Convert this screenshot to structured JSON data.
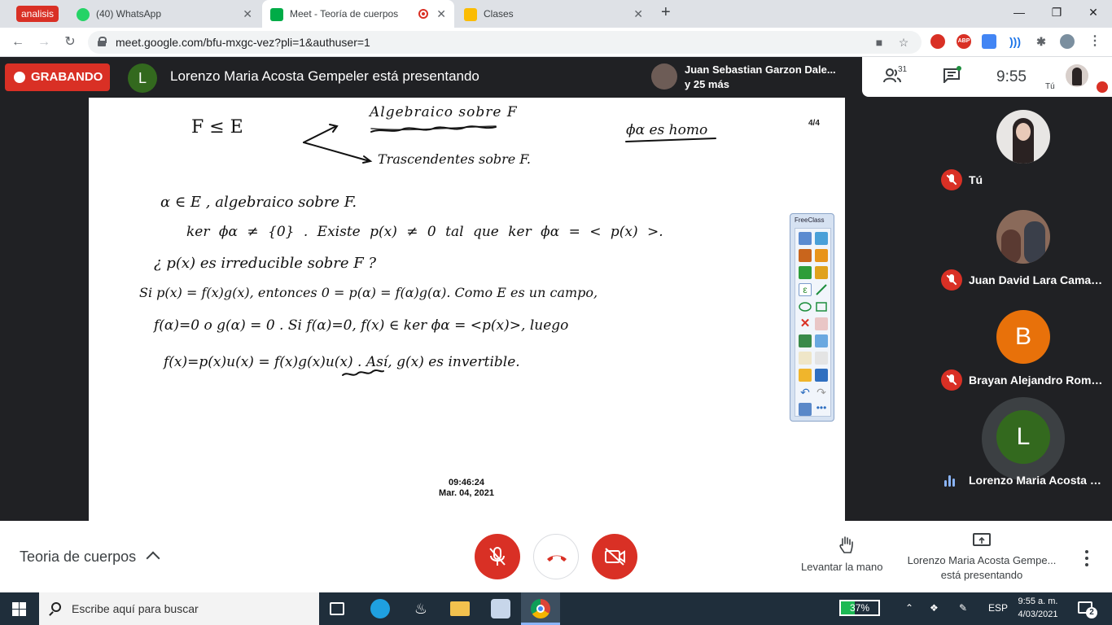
{
  "browser": {
    "group_label": "analisis",
    "tabs": [
      {
        "title": "(40) WhatsApp",
        "badge": "40"
      },
      {
        "title": "Meet - Teoría de cuerpos"
      },
      {
        "title": "Clases"
      }
    ],
    "url": "meet.google.com/bfu-mxgc-vez?pli=1&authuser=1",
    "window_controls": {
      "minimize": "—",
      "maximize": "❐",
      "close": "✕"
    },
    "new_tab": "+",
    "ext_abp": "ABP"
  },
  "meet": {
    "recording_label": "GRABANDO",
    "presenter_initial": "L",
    "presenting_text": "Lorenzo Maria Acosta Gempeler está presentando",
    "toast": {
      "name": "Juan Sebastian Garzon Dale...",
      "more": "y 25 más"
    },
    "participant_count": "31",
    "time": "9:55",
    "self_label": "Tú"
  },
  "slide": {
    "page": "4/4",
    "stamp_time": "09:46:24",
    "stamp_date": "Mar. 04, 2021",
    "handwriting_lines": [
      "F ≤ E",
      "Algebraico sobre F",
      "Trascendentes sobre F.",
      "ϕα es homo",
      "α ∈ E , algebraico sobre F.",
      "ker ϕα ≠ {0} . Existe p(x) ≠ 0 tal que ker ϕα = < p(x) >.",
      "¿ p(x) es irreducible sobre F ?",
      "Si p(x) = f(x)g(x), entonces 0 = p(α) = f(α)g(α). Como E es un campo,",
      "f(α)=0 o g(α) = 0 . Si f(α)=0, f(x) ∈ ker ϕα = <p(x)>, luego",
      "f(x)=p(x)u(x) = f(x)g(x)u(x) . Así, g(x) es invertible."
    ]
  },
  "freeclass": {
    "title": "FreeClass"
  },
  "participants": [
    {
      "name": "Tú",
      "initial": ""
    },
    {
      "name": "Juan David Lara Camacho",
      "initial": ""
    },
    {
      "name": "Brayan Alejandro Romero...",
      "initial": "B"
    },
    {
      "name": "Lorenzo Maria Acosta Ge...",
      "initial": "L"
    }
  ],
  "controls": {
    "meeting_title": "Teoria de cuerpos",
    "raise_hand": "Levantar la mano",
    "presenting_line1": "Lorenzo Maria Acosta Gempe...",
    "presenting_line2": "está presentando"
  },
  "taskbar": {
    "search_placeholder": "Escribe aquí para buscar",
    "battery_label": "37%",
    "battery_level": 0.37,
    "language": "ESP",
    "time": "9:55 a. m.",
    "date": "4/03/2021",
    "notifications": "2"
  },
  "colors": {
    "recording_red": "#d93025",
    "meet_dark": "#202124",
    "presenter_green": "#33691e",
    "brayan_orange": "#e8710a"
  }
}
